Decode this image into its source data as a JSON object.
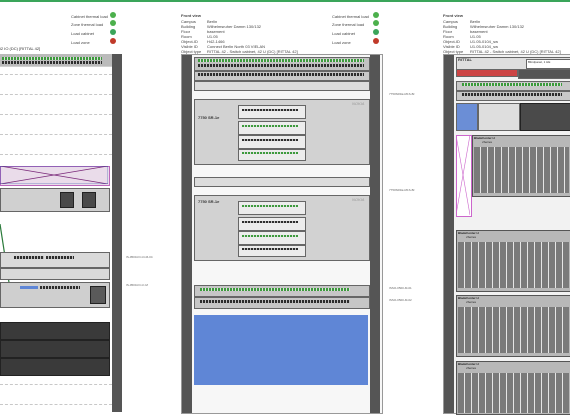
{
  "legend_left": {
    "items": [
      {
        "label": "Cabinet thermal load",
        "icon": "thermometer-green-icon"
      },
      {
        "label": "Zone thermal load",
        "icon": "thermometer-green-icon"
      },
      {
        "label": "Load cabinet",
        "icon": "load-green-icon"
      },
      {
        "label": "Load zone",
        "icon": "load-red-icon"
      }
    ]
  },
  "legend_right": {
    "items": [
      {
        "label": "Cabinet thermal load"
      },
      {
        "label": "Zone thermal load"
      },
      {
        "label": "Load cabinet"
      },
      {
        "label": "Load zone"
      }
    ]
  },
  "cabinet_left": {
    "object_type_fragment": "i2 IO (DC) [RITTAL 42]"
  },
  "cabinet_middle": {
    "view_title": "Front view",
    "props": [
      {
        "key": "Campus",
        "value": "Berlin"
      },
      {
        "key": "Building",
        "value": "Wilhelmsruher Damm 130/132"
      },
      {
        "key": "Floor",
        "value": "basement"
      },
      {
        "key": "Room",
        "value": "U1.05"
      },
      {
        "key": "Object-ID",
        "value": "H42-1466"
      },
      {
        "key": "Visible ID",
        "value": "Connect Berlin North 03 VIELAN"
      },
      {
        "key": "Object type",
        "value": "RITTAL 42 - Switch cabinet, 42 U (DC) [RITTAL 42]"
      }
    ],
    "device_label_1": "7750 SR-1e",
    "device_label_2": "7750 SR-1e",
    "brand": "NOKIA",
    "small_tag_1": "DWL-2248",
    "small_tag_2": "DWL-2248",
    "side_label_1": "7750SR1E-M1S-Br",
    "side_label_2": "7750SR1E-M1S-Br",
    "side_label_3": "ISSO-0500-M-01",
    "side_label_4": "ISSO-0500-M-02"
  },
  "cabinet_right": {
    "view_title": "Front view",
    "props": [
      {
        "key": "Campus",
        "value": "Berlin"
      },
      {
        "key": "Building",
        "value": "Wilhelmsruher Damm 130/132"
      },
      {
        "key": "Floor",
        "value": "basement"
      },
      {
        "key": "Room",
        "value": "U1.05"
      },
      {
        "key": "Object-ID",
        "value": "U1.05-0104_sw"
      },
      {
        "key": "Visible ID",
        "value": "U1.05-0104_sw"
      },
      {
        "key": "Object type",
        "value": "RITTAL 42 - Switch cabinet, 42 U (DC) [RITTAL 42]"
      }
    ],
    "brand": "RITTAL",
    "blind_panel": "Blindpanel, 1 HE",
    "blade_label": "BladeCenter H",
    "blade_sub": "xSeries",
    "blade_count": 6
  },
  "colors": {
    "accent_green": "#3aa55a",
    "blue_fill": "#5f86d6",
    "rack_frame": "#555555"
  }
}
